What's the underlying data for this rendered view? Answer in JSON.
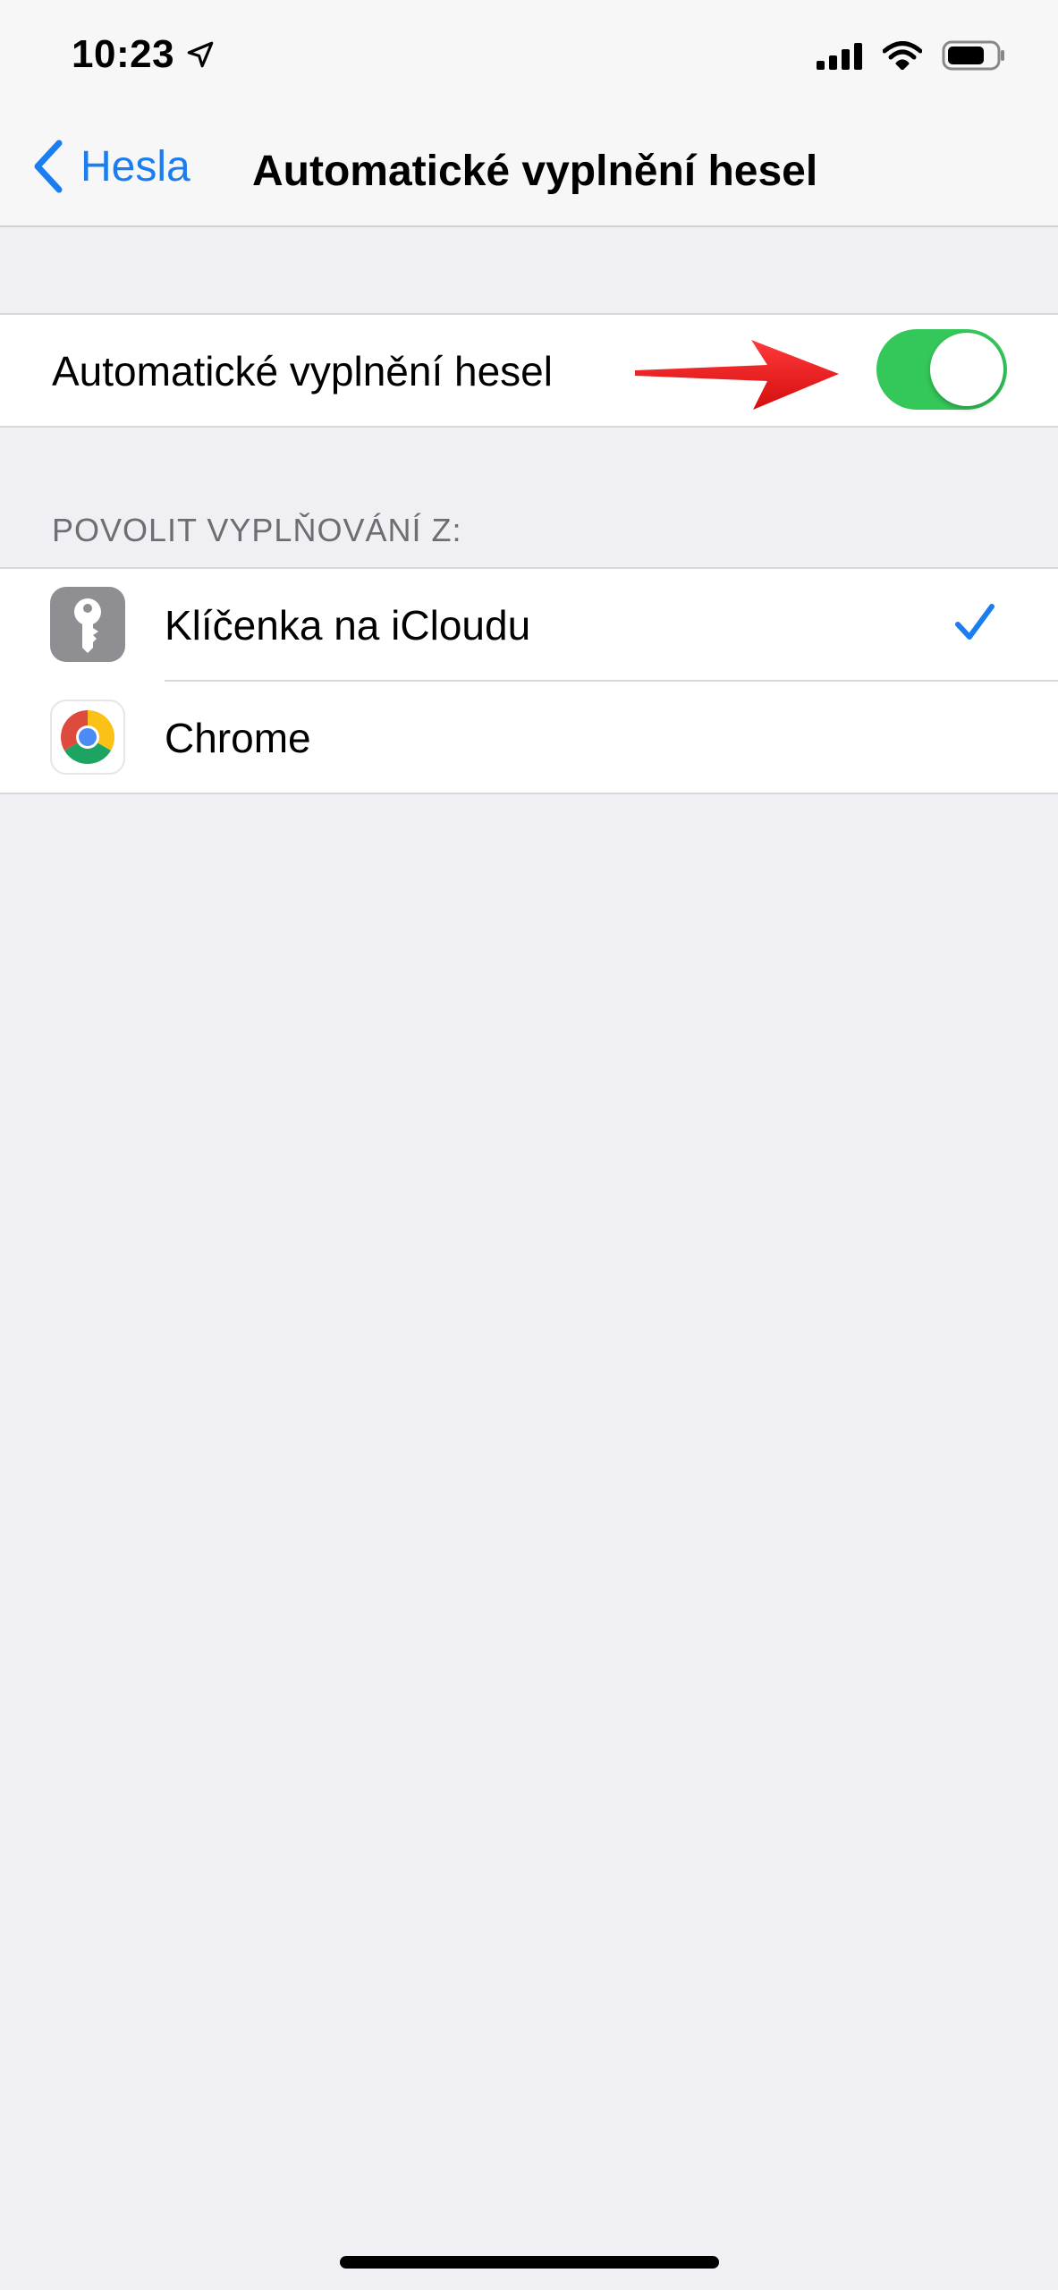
{
  "status_bar": {
    "time": "10:23",
    "icons": [
      "location-arrow-icon",
      "cellular-signal-icon",
      "wifi-icon",
      "battery-icon"
    ]
  },
  "nav": {
    "back_label": "Hesla",
    "title": "Automatické vyplnění hesel"
  },
  "toggle_row": {
    "label": "Automatické vyplnění hesel",
    "enabled": true,
    "annotation": "red-arrow-icon"
  },
  "section": {
    "header": "POVOLIT VYPLŇOVÁNÍ Z:",
    "items": [
      {
        "label": "Klíčenka na iCloudu",
        "icon": "keychain-icon",
        "selected": true
      },
      {
        "label": "Chrome",
        "icon": "chrome-icon",
        "selected": false
      }
    ]
  },
  "colors": {
    "accent": "#1a7df0",
    "switch_on": "#34c759",
    "annotation_arrow": "#ee1c1c",
    "background": "#efeff4"
  }
}
